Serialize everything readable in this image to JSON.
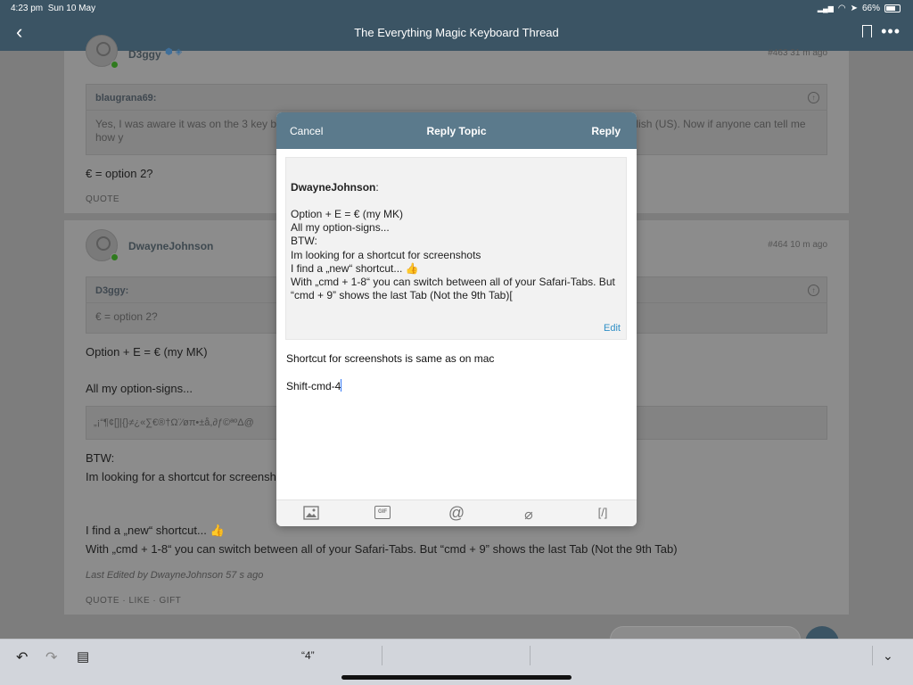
{
  "status": {
    "time": "4:23 pm",
    "date": "Sun 10 May",
    "battery": "66%"
  },
  "nav": {
    "title": "The Everything Magic Keyboard Thread"
  },
  "posts": [
    {
      "user": "D3ggy",
      "meta": "#463  31 m ago",
      "quote_user": "blaugrana69:",
      "quote_text": "Yes, I was aware it was on the 3 key b                                                                           English (UK) rather than English (US). Now if anyone can tell me how y",
      "body": [
        "€ = option 2?"
      ],
      "actions": "QUOTE"
    },
    {
      "user": "DwayneJohnson",
      "meta": "#464  10 m ago",
      "quote_user": "D3ggy:",
      "quote_text": "€ = option 2?",
      "body_line1": "Option + E = € (my MK)",
      "body_line2": "All my option-signs...",
      "symbols": "„¡“¶¢[]|{}≠¿«∑€®†Ω¨⁄øπ•±å,∂ƒ©ªºΔ@",
      "body_line3": "BTW:",
      "body_line4": "Im looking for a shortcut for screensh",
      "body_line5": "I find a „new“ shortcut... 👍",
      "body_line6": "With „cmd + 1-8“ you can switch between all of your Safari-Tabs. But “cmd + 9” shows the last Tab (Not the 9th Tab)",
      "edited": "Last Edited by DwayneJohnson 57 s ago",
      "actions": "QUOTE · LIKE · GIFT"
    }
  ],
  "modal": {
    "cancel": "Cancel",
    "title": "Reply Topic",
    "reply": "Reply",
    "quoted_user": "DwayneJohnson",
    "quoted_colon": ":",
    "quoted_lines": [
      "Option + E = € (my MK)",
      "All my option-signs...",
      "BTW:",
      "Im looking for a shortcut for screenshots",
      "I find a „new“ shortcut... 👍",
      "With „cmd + 1-8“ you can switch between all of your Safari-Tabs. But “cmd + 9” shows the last Tab (Not the 9th Tab)["
    ],
    "edit": "Edit",
    "reply_line1": "Shortcut for screenshots is same as on mac",
    "reply_line2": "Shift-cmd-4",
    "toolbar": {
      "gif": "GIF",
      "at": "@",
      "code": "[/]"
    }
  },
  "keyboard": {
    "suggestion": "“4”"
  }
}
